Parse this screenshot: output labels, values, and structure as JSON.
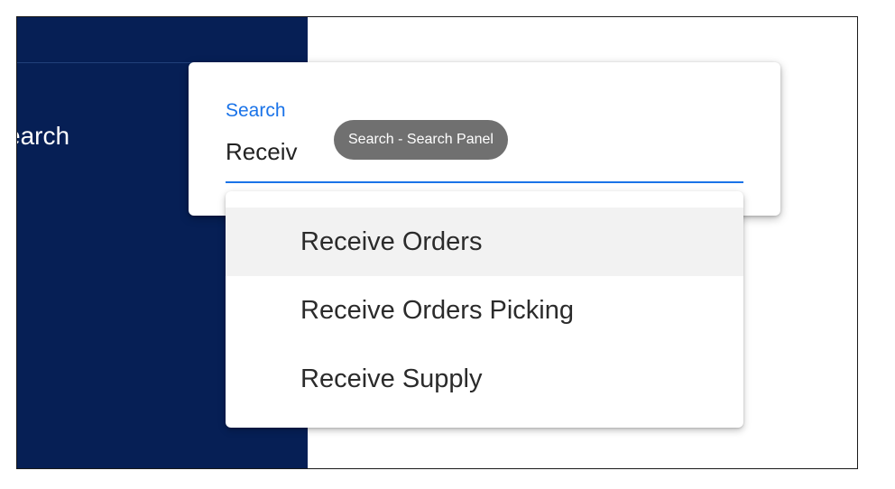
{
  "sidebar": {
    "item_label": "earch",
    "background_color": "#061f55"
  },
  "search_panel": {
    "field_label": "Search",
    "input_value": "Receiv",
    "accent_color": "#1a73e8",
    "tooltip": "Search - Search Panel"
  },
  "dropdown": {
    "items": [
      {
        "label": "Receive Orders",
        "highlighted": true
      },
      {
        "label": "Receive Orders Picking",
        "highlighted": false
      },
      {
        "label": "Receive Supply",
        "highlighted": false
      }
    ]
  }
}
